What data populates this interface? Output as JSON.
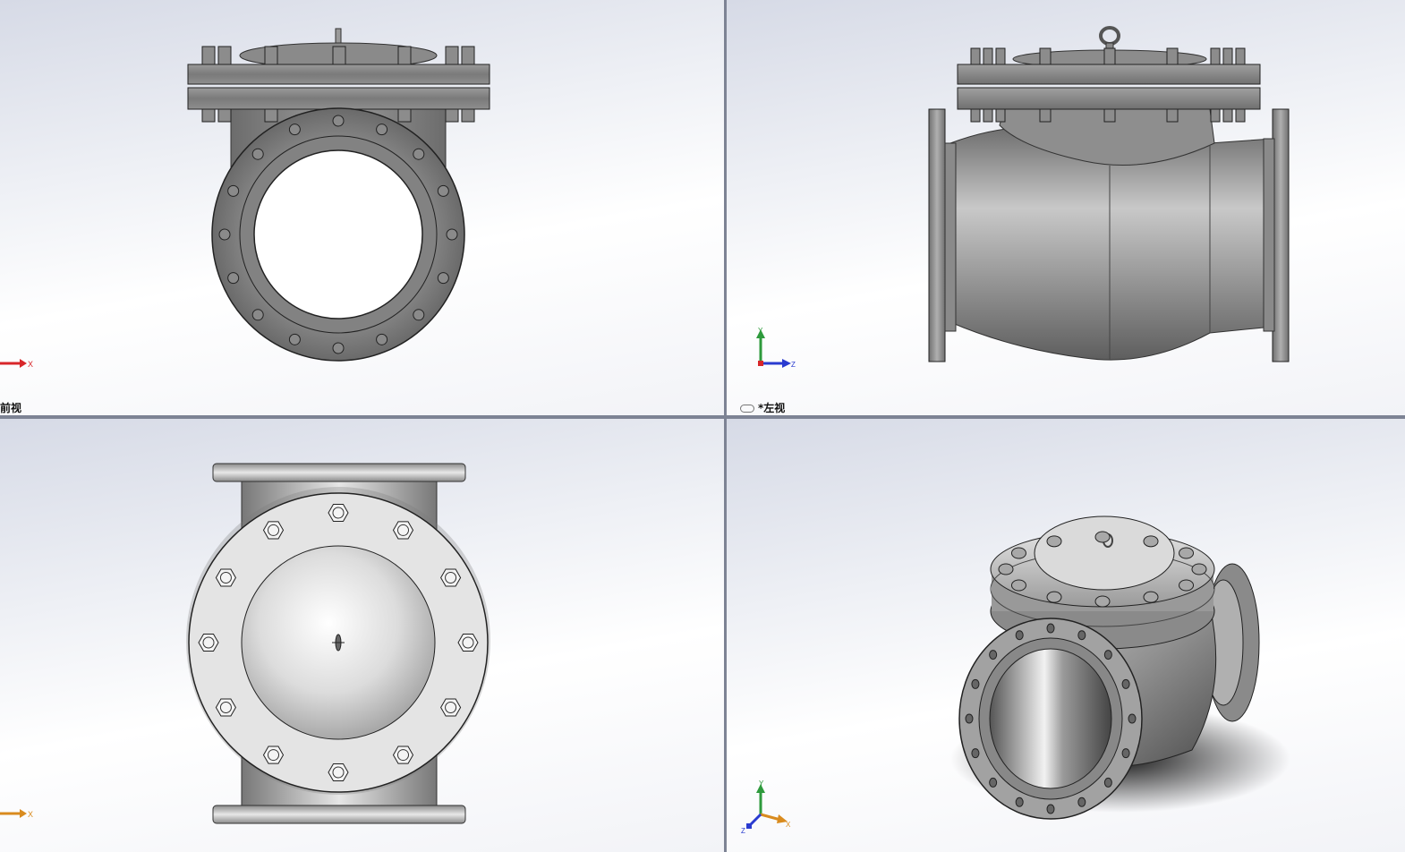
{
  "viewports": {
    "front": {
      "label": "前视"
    },
    "left": {
      "label": "*左视"
    },
    "top": {
      "label": ""
    },
    "iso": {
      "label": ""
    }
  },
  "toolbar": {
    "icons": [
      "zoom-to-fit-icon",
      "zoom-area-icon",
      "previous-view-icon",
      "section-view-icon",
      "view-orientation-icon",
      "display-style-icon",
      "hide-show-icon",
      "edit-appearance-icon",
      "apply-scene-icon",
      "view-settings-icon"
    ]
  },
  "triad": {
    "x": "X",
    "y": "Y",
    "z": "Z"
  },
  "colors": {
    "x_axis": "#d8262a",
    "y_axis": "#2e9a3c",
    "z_axis": "#2a3bd0",
    "x_axis_alt": "#d98b1e",
    "viewport_divider": "#7d8394",
    "metal": "#8c8c8c"
  }
}
